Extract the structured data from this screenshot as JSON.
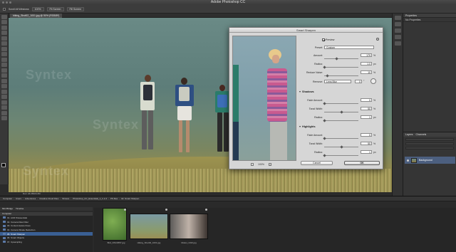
{
  "app": {
    "title": "Adobe Photoshop CC"
  },
  "options_bar": {
    "scroll_all_label": "Scroll All Windows",
    "zoom_label": "100%",
    "fit_label": "Fit Screen",
    "fill_label": "Fill Screen"
  },
  "document": {
    "tab_label": "hiking_Shot02_1001.jpg @ 50% (RGB/8*)",
    "status": "Doc: 24.2M/24.2M"
  },
  "watermark": "Syntex",
  "panels": {
    "properties_title": "Properties",
    "properties_subtitle": "No Properties",
    "layers_tab": "Layers",
    "channels_tab": "Channels",
    "layer_name": "Background"
  },
  "dialog": {
    "title": "Smart Sharpen",
    "preview_label": "Preview",
    "preset_label": "Preset:",
    "preset_value": "Custom",
    "amount_label": "Amount:",
    "amount_value": "179",
    "amount_unit": "%",
    "amount_level": 0.36,
    "radius_label": "Radius:",
    "radius_value": "1.0",
    "radius_unit": "px",
    "radius_level": 0.02,
    "reduce_noise_label": "Reduce Noise:",
    "reduce_noise_value": "10",
    "reduce_noise_unit": "%",
    "reduce_noise_level": 0.1,
    "remove_label": "Remove:",
    "remove_value": "Lens Blur",
    "remove_angle": "0",
    "shadows_title": "Shadows",
    "shadows_fade_label": "Fade Amount:",
    "shadows_fade_value": "0",
    "shadows_fade_unit": "%",
    "shadows_fade_level": 0,
    "shadows_tonal_label": "Tonal Width:",
    "shadows_tonal_value": "50",
    "shadows_tonal_unit": "%",
    "shadows_tonal_level": 0.5,
    "shadows_radius_label": "Radius:",
    "shadows_radius_value": "1",
    "shadows_radius_unit": "px",
    "shadows_radius_level": 0.01,
    "highlights_title": "Highlights",
    "highlights_fade_label": "Fade Amount:",
    "highlights_fade_value": "0",
    "highlights_fade_unit": "%",
    "highlights_fade_level": 0,
    "highlights_tonal_label": "Tonal Width:",
    "highlights_tonal_value": "50",
    "highlights_tonal_unit": "%",
    "highlights_tonal_level": 0.5,
    "highlights_radius_label": "Radius:",
    "highlights_radius_value": "1",
    "highlights_radius_unit": "px",
    "highlights_radius_level": 0.01,
    "zoom_value": "100%",
    "cancel_label": "Cancel",
    "ok_label": "OK"
  },
  "bridge": {
    "crumbs": [
      "Computer",
      "Users",
      "Adventures",
      "Creative Cloud Files",
      "Shrews",
      "Photoshop_CC_Essentials_1_1-1-3",
      "PS files",
      "02. Smart Sharpen"
    ],
    "filter_tabs": [
      "Mini Bridge",
      "Timeline"
    ],
    "folder_header": "Computer",
    "folders": [
      "01. ACR 8 Essentials",
      "02. Camera Raw Filter",
      "03. Content Aware Fixes",
      "04. Camera Shake Reduction",
      "05. Smart Sharpen",
      "06. Smart Objects",
      "07. Upsampling"
    ],
    "selected_folder_index": 4,
    "thumbnails": [
      {
        "caption": "Bird_DSC0657.jpg"
      },
      {
        "caption": "Hiking_Shot02_1001.jpg"
      },
      {
        "caption": "Model_1010.jpg"
      }
    ]
  }
}
